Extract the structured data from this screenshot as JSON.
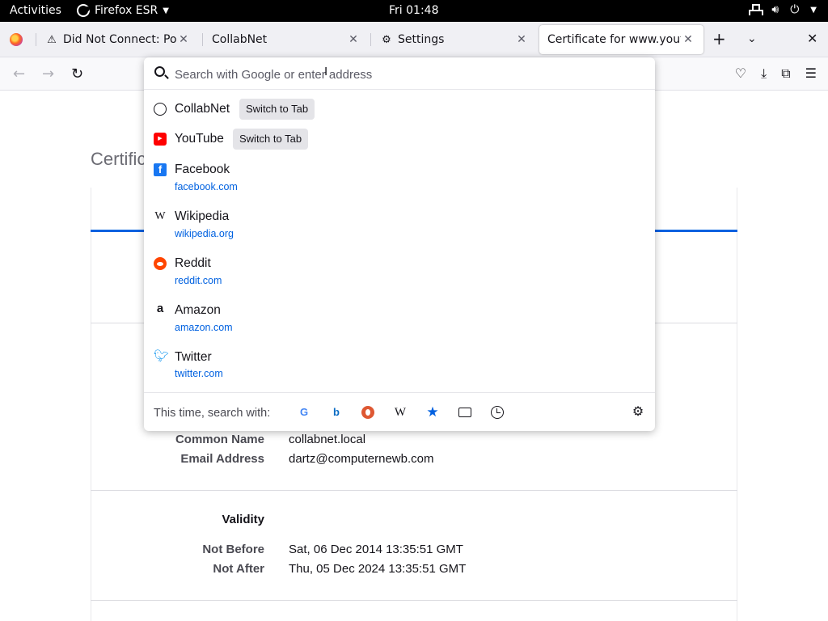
{
  "topbar": {
    "activities": "Activities",
    "app_name": "Firefox ESR",
    "clock": "Fri 01:48"
  },
  "tabs": [
    {
      "label": "Did Not Connect: Potential Security Issue",
      "icon": "warning-icon"
    },
    {
      "label": "CollabNet",
      "icon": ""
    },
    {
      "label": "Settings",
      "icon": "gear-icon"
    },
    {
      "label": "Certificate for www.youtube.com",
      "icon": "",
      "active": true
    }
  ],
  "urlbar": {
    "placeholder": "Search with Google or enter address",
    "value": ""
  },
  "results": [
    {
      "title": "CollabNet",
      "action": "Switch to Tab",
      "icon": "globe-icon"
    },
    {
      "title": "YouTube",
      "action": "Switch to Tab",
      "icon": "youtube-icon"
    },
    {
      "title": "Facebook",
      "url": "facebook.com",
      "icon": "facebook-icon"
    },
    {
      "title": "Wikipedia",
      "url": "wikipedia.org",
      "icon": "wikipedia-icon"
    },
    {
      "title": "Reddit",
      "url": "reddit.com",
      "icon": "reddit-icon"
    },
    {
      "title": "Amazon",
      "url": "amazon.com",
      "icon": "amazon-icon"
    },
    {
      "title": "Twitter",
      "url": "twitter.com",
      "icon": "twitter-icon"
    }
  ],
  "oneoffs": {
    "label": "This time, search with:",
    "engines": [
      "google-icon",
      "bing-icon",
      "duckduckgo-icon",
      "wikipedia-icon",
      "bookmarks-icon",
      "tabs-icon",
      "history-icon",
      "settings-gear-icon"
    ]
  },
  "page": {
    "title": "Certificate",
    "subject": {
      "common_name_label": "Common Name",
      "common_name": "collabnet.local",
      "email_label": "Email Address",
      "email": "dartz@computernewb.com"
    },
    "validity": {
      "title": "Validity",
      "not_before_label": "Not Before",
      "not_before": "Sat, 06 Dec 2014 13:35:51 GMT",
      "not_after_label": "Not After",
      "not_after": "Thu, 05 Dec 2024 13:35:51 GMT"
    }
  },
  "colors": {
    "accent": "#0061e0",
    "topbar": "#000000",
    "tabstrip": "#f0f0f4"
  }
}
